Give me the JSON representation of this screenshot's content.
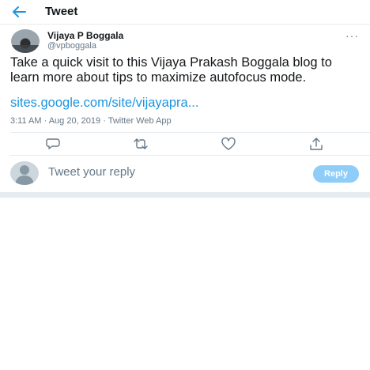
{
  "header": {
    "title": "Tweet",
    "back_icon": "arrow-left-icon"
  },
  "author": {
    "name": "Vijaya P Boggala",
    "handle": "@vpboggala",
    "more_icon": "more-horizontal-icon"
  },
  "tweet": {
    "text": "Take a quick visit to this Vijaya Prakash Boggala blog to learn more about tips to maximize autofocus mode.",
    "link": "sites.google.com/site/vijayapra...",
    "meta": "3:11 AM · Aug 20, 2019 · Twitter Web App"
  },
  "actions": [
    "reply-icon",
    "retweet-icon",
    "like-icon",
    "share-icon"
  ],
  "reply": {
    "placeholder": "Tweet your reply",
    "button_label": "Reply"
  },
  "colors": {
    "accent": "#1b95e0",
    "reply_button": "#8ecdf8",
    "muted": "#657786",
    "border": "#e6ecf0"
  }
}
